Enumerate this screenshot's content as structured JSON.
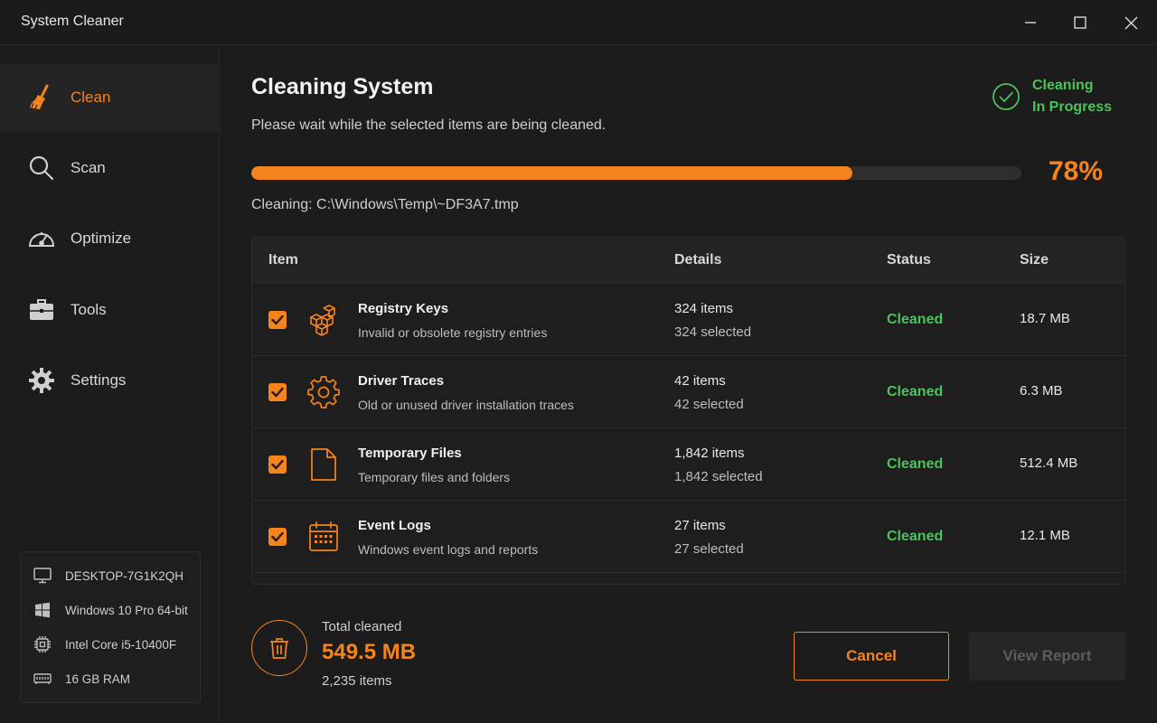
{
  "window": {
    "title": "System Cleaner"
  },
  "sidebar": {
    "items": [
      {
        "label": "Clean",
        "icon": "broom-icon",
        "active": true
      },
      {
        "label": "Scan",
        "icon": "search-icon",
        "active": false
      },
      {
        "label": "Optimize",
        "icon": "speedometer-icon",
        "active": false
      },
      {
        "label": "Tools",
        "icon": "toolbox-icon",
        "active": false
      },
      {
        "label": "Settings",
        "icon": "gear-icon",
        "active": false
      }
    ],
    "system_info": [
      {
        "icon": "monitor-icon",
        "text": "DESKTOP-7G1K2QH"
      },
      {
        "icon": "windows-logo-icon",
        "text": "Windows 10 Pro 64-bit"
      },
      {
        "icon": "cpu-icon",
        "text": "Intel Core i5-10400F"
      },
      {
        "icon": "memory-icon",
        "text": "16 GB RAM"
      }
    ]
  },
  "main": {
    "title": "Cleaning System",
    "subtitle": "Please wait while the selected items are being cleaned.",
    "status": {
      "line1": "Cleaning",
      "line2": "In Progress"
    },
    "progress": {
      "value": 0.78,
      "label": "78%"
    },
    "current_file": "Cleaning: C:\\Windows\\Temp\\~DF3A7.tmp",
    "table": {
      "headers": {
        "item": "Item",
        "details": "Details",
        "status": "Status",
        "size": "Size"
      },
      "rows": [
        {
          "icon": "registry-cubes-icon",
          "name": "Registry Keys",
          "desc": "Invalid or obsolete registry entries",
          "count": "324 items",
          "selected": "324 selected",
          "status": "Cleaned",
          "size": "18.7 MB",
          "checked": true
        },
        {
          "icon": "gear-icon",
          "name": "Driver Traces",
          "desc": "Old or unused driver installation traces",
          "count": "42 items",
          "selected": "42 selected",
          "status": "Cleaned",
          "size": "6.3 MB",
          "checked": true
        },
        {
          "icon": "file-icon",
          "name": "Temporary Files",
          "desc": "Temporary files and folders",
          "count": "1,842 items",
          "selected": "1,842 selected",
          "status": "Cleaned",
          "size": "512.4 MB",
          "checked": true
        },
        {
          "icon": "calendar-icon",
          "name": "Event Logs",
          "desc": "Windows event logs and reports",
          "count": "27 items",
          "selected": "27 selected",
          "status": "Cleaned",
          "size": "12.1 MB",
          "checked": true
        }
      ]
    },
    "summary": {
      "label": "Total cleaned",
      "size": "549.5 MB",
      "items": "2,235 items"
    },
    "buttons": {
      "cancel": "Cancel",
      "view_report": "View Report"
    }
  },
  "colors": {
    "accent": "#f5841f",
    "success": "#4cc35a",
    "background": "#1c1c1c"
  }
}
